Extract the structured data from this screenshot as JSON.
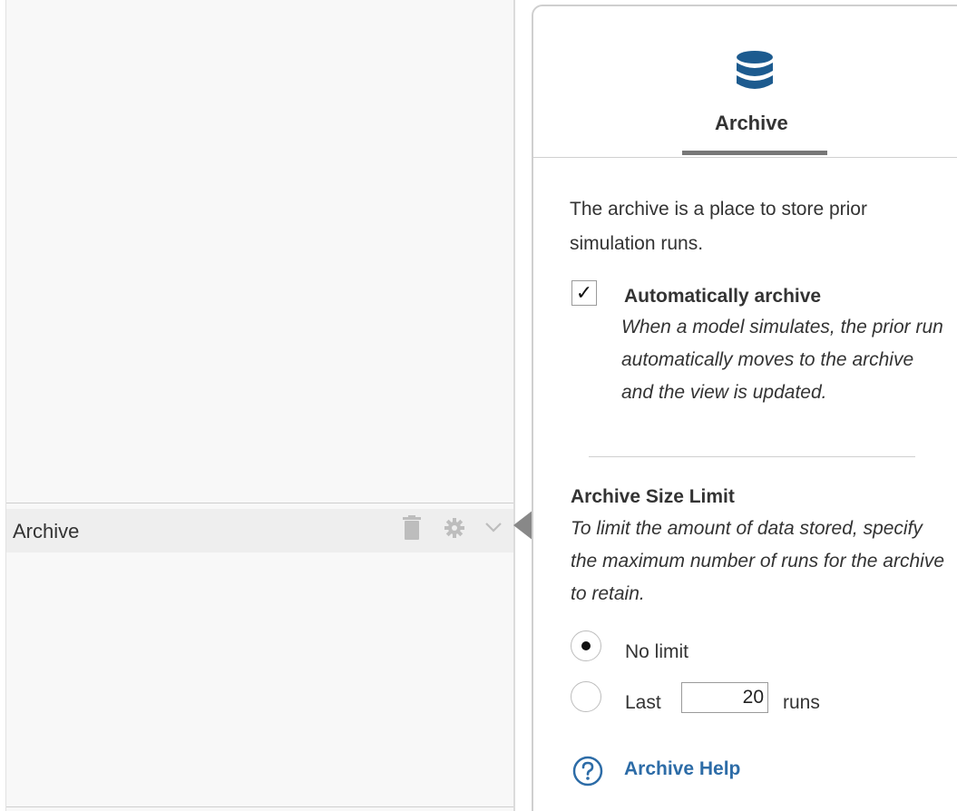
{
  "left_panel": {
    "archive_row": {
      "label": "Archive",
      "icons": [
        "trash-icon",
        "gear-icon",
        "chevron-down-icon"
      ]
    }
  },
  "right_panel": {
    "tab": {
      "icon": "database-icon",
      "label": "Archive"
    },
    "intro": "The archive is a place to store prior simulation runs.",
    "auto_archive": {
      "checked": true,
      "check_glyph": "✓",
      "title": "Automatically archive",
      "description": "When a model simulates, the prior run automatically moves to the archive and the view is updated."
    },
    "size_limit": {
      "title": "Archive Size Limit",
      "description": "To limit the amount of data stored, specify the maximum number of runs for the archive to retain.",
      "options": {
        "no_limit": {
          "label": "No limit",
          "selected": true
        },
        "last": {
          "label": "Last",
          "value": "20",
          "suffix": "runs",
          "selected": false
        }
      }
    },
    "help": {
      "icon": "help-circle-icon",
      "label": "Archive Help"
    }
  },
  "colors": {
    "accent": "#2d6ca7",
    "db_icon": "#1d5b8f",
    "tab_underline": "#777777"
  }
}
